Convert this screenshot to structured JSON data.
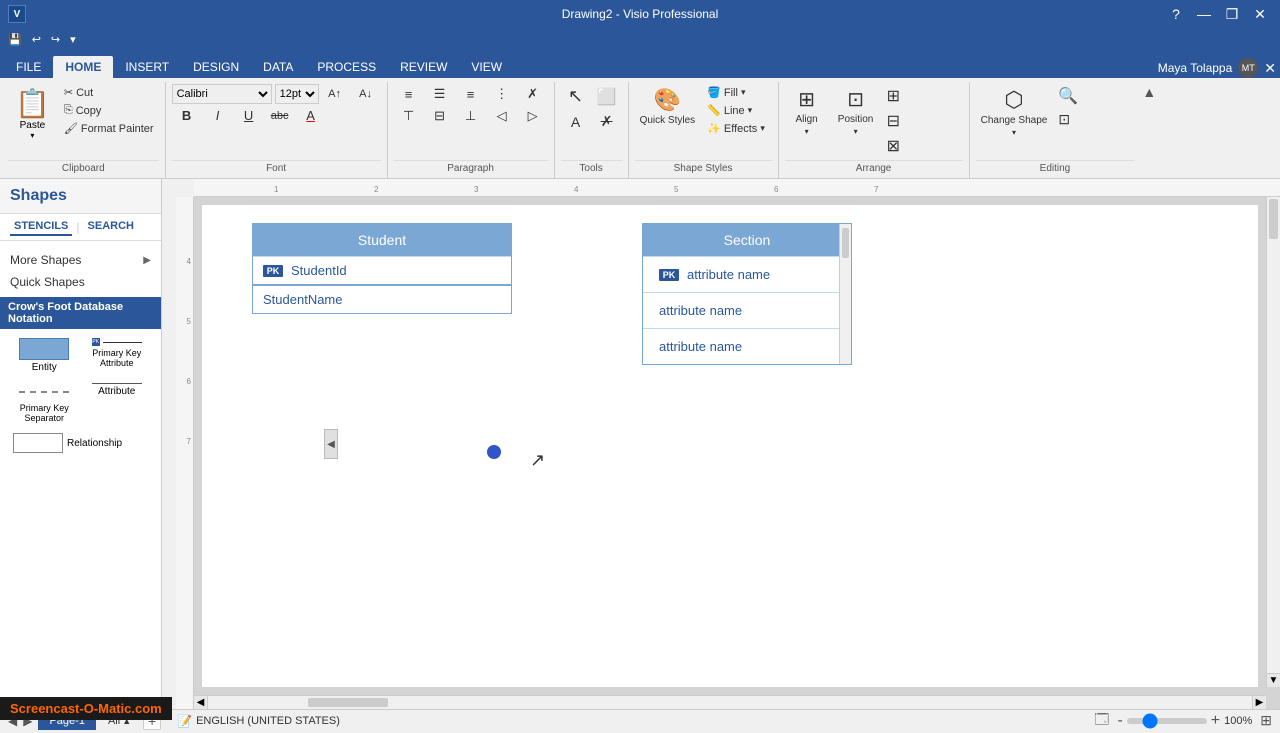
{
  "titleBar": {
    "title": "Drawing2 - Visio Professional",
    "logoText": "V",
    "helpBtn": "?",
    "minBtn": "—",
    "maxBtn": "❒",
    "closeBtn": "✕"
  },
  "quickAccess": {
    "buttons": [
      "💾",
      "↩",
      "↪",
      "▾"
    ]
  },
  "ribbonTabs": {
    "tabs": [
      "FILE",
      "HOME",
      "INSERT",
      "DESIGN",
      "DATA",
      "PROCESS",
      "REVIEW",
      "VIEW"
    ],
    "activeTab": "HOME"
  },
  "userArea": {
    "name": "Maya Tolappa",
    "closeBtn": "✕"
  },
  "ribbon": {
    "groups": [
      {
        "label": "Clipboard",
        "id": "clipboard"
      },
      {
        "label": "Font",
        "id": "font"
      },
      {
        "label": "Paragraph",
        "id": "paragraph"
      },
      {
        "label": "Tools",
        "id": "tools"
      },
      {
        "label": "Shape Styles",
        "id": "shape-styles"
      },
      {
        "label": "Arrange",
        "id": "arrange"
      },
      {
        "label": "Editing",
        "id": "editing"
      }
    ],
    "clipboard": {
      "pasteLabel": "Paste",
      "cutLabel": "Cut",
      "copyLabel": "Copy",
      "formatLabel": "Format Painter"
    },
    "font": {
      "fontName": "Calibri",
      "fontSize": "12pt",
      "boldLabel": "B",
      "italicLabel": "I",
      "underlineLabel": "U",
      "strikeLabel": "abc",
      "fontColorLabel": "A"
    },
    "shapeStyles": {
      "fillLabel": "Fill",
      "lineLabel": "Line",
      "effectsLabel": "Effects",
      "quickStylesLabel": "Quick Styles"
    },
    "arrange": {
      "alignLabel": "Align",
      "positionLabel": "Position"
    },
    "editing": {
      "changeShapeLabel": "Change Shape"
    }
  },
  "sidebar": {
    "title": "Shapes",
    "tabs": [
      "STENCILS",
      "SEARCH"
    ],
    "menuItems": [
      {
        "label": "More Shapes",
        "hasArrow": true
      },
      {
        "label": "Quick Shapes",
        "hasArrow": false
      }
    ],
    "stencilName": "Crow's Foot Database Notation",
    "shapes": [
      {
        "id": "entity",
        "label": "Entity",
        "type": "entity"
      },
      {
        "id": "pk-separator",
        "label": "Primary Key Separator",
        "type": "pk-sep"
      },
      {
        "id": "primary-attr",
        "label": "Primary Key Attribute",
        "type": "pk-attr"
      },
      {
        "id": "attribute",
        "label": "Attribute",
        "type": "attribute"
      },
      {
        "id": "relationship",
        "label": "Relationship",
        "type": "relationship"
      }
    ]
  },
  "canvas": {
    "studentTable": {
      "title": "Student",
      "rows": [
        {
          "badge": "PK",
          "text": "StudentId"
        },
        {
          "badge": "",
          "text": "StudentName"
        }
      ]
    },
    "sectionTable": {
      "title": "Section",
      "rows": [
        {
          "badge": "PK",
          "text": "attribute name"
        },
        {
          "badge": "",
          "text": "attribute name"
        },
        {
          "badge": "",
          "text": "attribute name"
        }
      ]
    }
  },
  "statusBar": {
    "pages": [
      "Page-1"
    ],
    "allPages": "All",
    "language": "ENGLISH (UNITED STATES)",
    "zoomPercent": "100%",
    "fitPageBtn": "⊞"
  },
  "watermark": "Screencast-O-Matic.com",
  "icons": {
    "collapse": "◀",
    "arrowRight": "▶",
    "arrowDown": "▼",
    "check": "✓",
    "expand": "+"
  }
}
